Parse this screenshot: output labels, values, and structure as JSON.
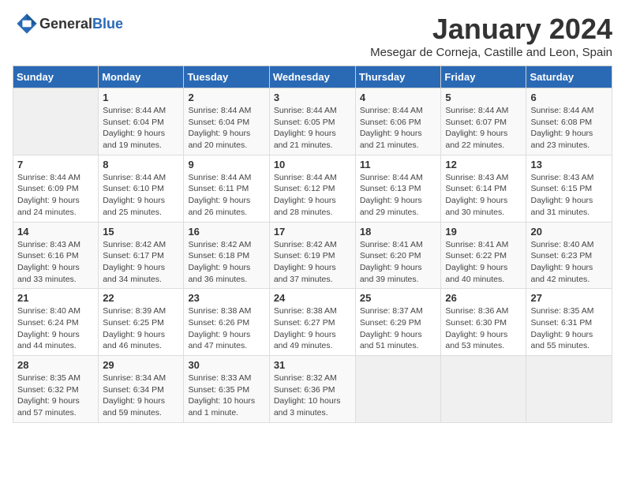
{
  "header": {
    "logo_general": "General",
    "logo_blue": "Blue",
    "month_title": "January 2024",
    "location": "Mesegar de Corneja, Castille and Leon, Spain"
  },
  "weekdays": [
    "Sunday",
    "Monday",
    "Tuesday",
    "Wednesday",
    "Thursday",
    "Friday",
    "Saturday"
  ],
  "weeks": [
    [
      {
        "day": "",
        "sunrise": "",
        "sunset": "",
        "daylight": ""
      },
      {
        "day": "1",
        "sunrise": "Sunrise: 8:44 AM",
        "sunset": "Sunset: 6:04 PM",
        "daylight": "Daylight: 9 hours and 19 minutes."
      },
      {
        "day": "2",
        "sunrise": "Sunrise: 8:44 AM",
        "sunset": "Sunset: 6:04 PM",
        "daylight": "Daylight: 9 hours and 20 minutes."
      },
      {
        "day": "3",
        "sunrise": "Sunrise: 8:44 AM",
        "sunset": "Sunset: 6:05 PM",
        "daylight": "Daylight: 9 hours and 21 minutes."
      },
      {
        "day": "4",
        "sunrise": "Sunrise: 8:44 AM",
        "sunset": "Sunset: 6:06 PM",
        "daylight": "Daylight: 9 hours and 21 minutes."
      },
      {
        "day": "5",
        "sunrise": "Sunrise: 8:44 AM",
        "sunset": "Sunset: 6:07 PM",
        "daylight": "Daylight: 9 hours and 22 minutes."
      },
      {
        "day": "6",
        "sunrise": "Sunrise: 8:44 AM",
        "sunset": "Sunset: 6:08 PM",
        "daylight": "Daylight: 9 hours and 23 minutes."
      }
    ],
    [
      {
        "day": "7",
        "sunrise": "Sunrise: 8:44 AM",
        "sunset": "Sunset: 6:09 PM",
        "daylight": "Daylight: 9 hours and 24 minutes."
      },
      {
        "day": "8",
        "sunrise": "Sunrise: 8:44 AM",
        "sunset": "Sunset: 6:10 PM",
        "daylight": "Daylight: 9 hours and 25 minutes."
      },
      {
        "day": "9",
        "sunrise": "Sunrise: 8:44 AM",
        "sunset": "Sunset: 6:11 PM",
        "daylight": "Daylight: 9 hours and 26 minutes."
      },
      {
        "day": "10",
        "sunrise": "Sunrise: 8:44 AM",
        "sunset": "Sunset: 6:12 PM",
        "daylight": "Daylight: 9 hours and 28 minutes."
      },
      {
        "day": "11",
        "sunrise": "Sunrise: 8:44 AM",
        "sunset": "Sunset: 6:13 PM",
        "daylight": "Daylight: 9 hours and 29 minutes."
      },
      {
        "day": "12",
        "sunrise": "Sunrise: 8:43 AM",
        "sunset": "Sunset: 6:14 PM",
        "daylight": "Daylight: 9 hours and 30 minutes."
      },
      {
        "day": "13",
        "sunrise": "Sunrise: 8:43 AM",
        "sunset": "Sunset: 6:15 PM",
        "daylight": "Daylight: 9 hours and 31 minutes."
      }
    ],
    [
      {
        "day": "14",
        "sunrise": "Sunrise: 8:43 AM",
        "sunset": "Sunset: 6:16 PM",
        "daylight": "Daylight: 9 hours and 33 minutes."
      },
      {
        "day": "15",
        "sunrise": "Sunrise: 8:42 AM",
        "sunset": "Sunset: 6:17 PM",
        "daylight": "Daylight: 9 hours and 34 minutes."
      },
      {
        "day": "16",
        "sunrise": "Sunrise: 8:42 AM",
        "sunset": "Sunset: 6:18 PM",
        "daylight": "Daylight: 9 hours and 36 minutes."
      },
      {
        "day": "17",
        "sunrise": "Sunrise: 8:42 AM",
        "sunset": "Sunset: 6:19 PM",
        "daylight": "Daylight: 9 hours and 37 minutes."
      },
      {
        "day": "18",
        "sunrise": "Sunrise: 8:41 AM",
        "sunset": "Sunset: 6:20 PM",
        "daylight": "Daylight: 9 hours and 39 minutes."
      },
      {
        "day": "19",
        "sunrise": "Sunrise: 8:41 AM",
        "sunset": "Sunset: 6:22 PM",
        "daylight": "Daylight: 9 hours and 40 minutes."
      },
      {
        "day": "20",
        "sunrise": "Sunrise: 8:40 AM",
        "sunset": "Sunset: 6:23 PM",
        "daylight": "Daylight: 9 hours and 42 minutes."
      }
    ],
    [
      {
        "day": "21",
        "sunrise": "Sunrise: 8:40 AM",
        "sunset": "Sunset: 6:24 PM",
        "daylight": "Daylight: 9 hours and 44 minutes."
      },
      {
        "day": "22",
        "sunrise": "Sunrise: 8:39 AM",
        "sunset": "Sunset: 6:25 PM",
        "daylight": "Daylight: 9 hours and 46 minutes."
      },
      {
        "day": "23",
        "sunrise": "Sunrise: 8:38 AM",
        "sunset": "Sunset: 6:26 PM",
        "daylight": "Daylight: 9 hours and 47 minutes."
      },
      {
        "day": "24",
        "sunrise": "Sunrise: 8:38 AM",
        "sunset": "Sunset: 6:27 PM",
        "daylight": "Daylight: 9 hours and 49 minutes."
      },
      {
        "day": "25",
        "sunrise": "Sunrise: 8:37 AM",
        "sunset": "Sunset: 6:29 PM",
        "daylight": "Daylight: 9 hours and 51 minutes."
      },
      {
        "day": "26",
        "sunrise": "Sunrise: 8:36 AM",
        "sunset": "Sunset: 6:30 PM",
        "daylight": "Daylight: 9 hours and 53 minutes."
      },
      {
        "day": "27",
        "sunrise": "Sunrise: 8:35 AM",
        "sunset": "Sunset: 6:31 PM",
        "daylight": "Daylight: 9 hours and 55 minutes."
      }
    ],
    [
      {
        "day": "28",
        "sunrise": "Sunrise: 8:35 AM",
        "sunset": "Sunset: 6:32 PM",
        "daylight": "Daylight: 9 hours and 57 minutes."
      },
      {
        "day": "29",
        "sunrise": "Sunrise: 8:34 AM",
        "sunset": "Sunset: 6:34 PM",
        "daylight": "Daylight: 9 hours and 59 minutes."
      },
      {
        "day": "30",
        "sunrise": "Sunrise: 8:33 AM",
        "sunset": "Sunset: 6:35 PM",
        "daylight": "Daylight: 10 hours and 1 minute."
      },
      {
        "day": "31",
        "sunrise": "Sunrise: 8:32 AM",
        "sunset": "Sunset: 6:36 PM",
        "daylight": "Daylight: 10 hours and 3 minutes."
      },
      {
        "day": "",
        "sunrise": "",
        "sunset": "",
        "daylight": ""
      },
      {
        "day": "",
        "sunrise": "",
        "sunset": "",
        "daylight": ""
      },
      {
        "day": "",
        "sunrise": "",
        "sunset": "",
        "daylight": ""
      }
    ]
  ]
}
